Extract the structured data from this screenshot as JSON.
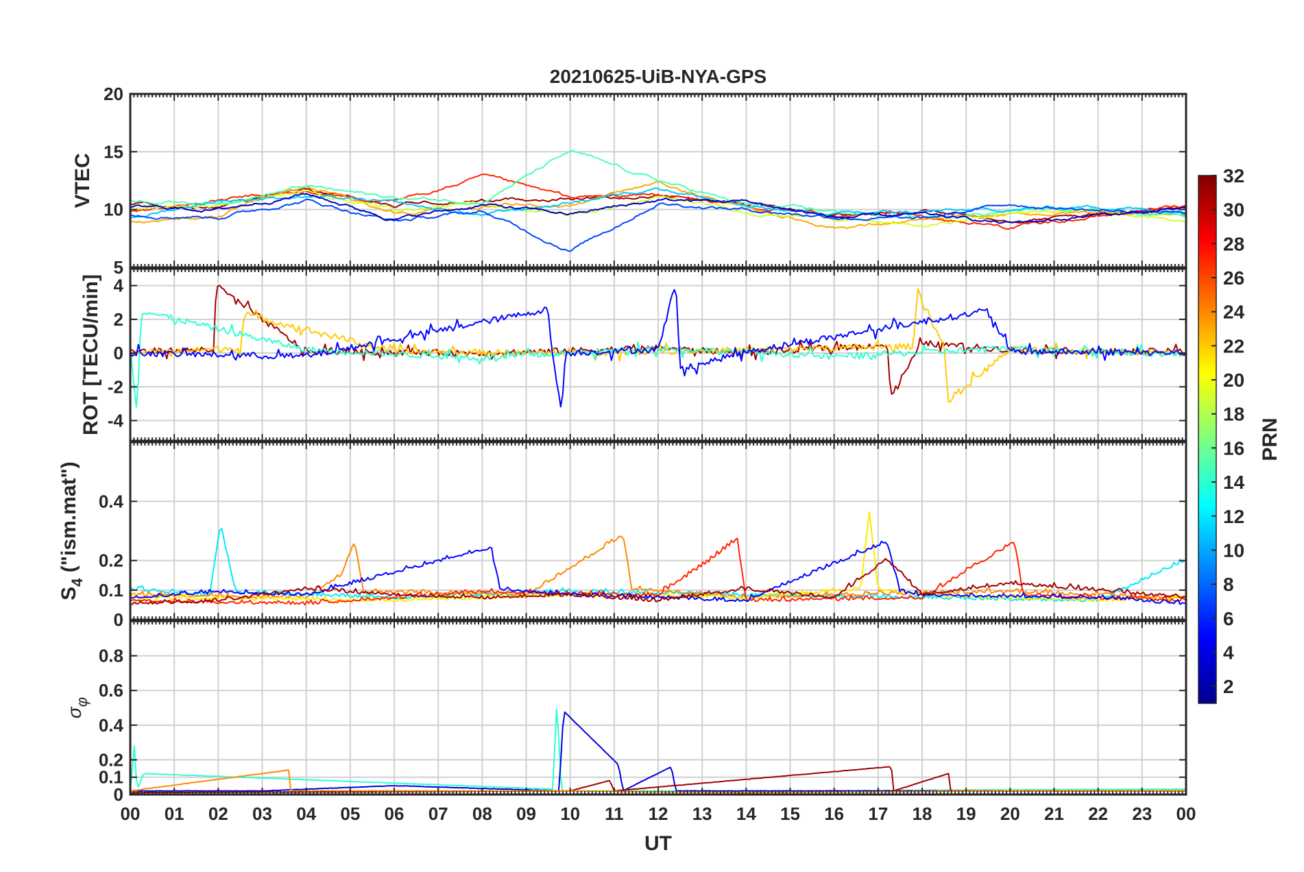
{
  "chart_data": {
    "type": "line",
    "title": "20210625-UiB-NYA-GPS",
    "xlabel": "UT",
    "x_tick_labels": [
      "00",
      "01",
      "02",
      "03",
      "04",
      "05",
      "06",
      "07",
      "08",
      "09",
      "10",
      "11",
      "12",
      "13",
      "14",
      "15",
      "16",
      "17",
      "18",
      "19",
      "20",
      "21",
      "22",
      "23",
      "00"
    ],
    "x_range_hours": [
      0,
      24
    ],
    "grid": true,
    "colormap": "jet",
    "colorbar": {
      "label": "PRN",
      "range": [
        1,
        32
      ],
      "ticks": [
        2,
        4,
        6,
        8,
        10,
        12,
        14,
        16,
        18,
        20,
        22,
        24,
        26,
        28,
        30,
        32
      ],
      "tick_labels": [
        "2",
        "4",
        "6",
        "8",
        "10",
        "12",
        "14",
        "16",
        "18",
        "20",
        "22",
        "24",
        "26",
        "28",
        "30",
        "32"
      ]
    },
    "panels": [
      {
        "id": "vtec",
        "ylabel": "VTEC",
        "ylim": [
          5,
          20
        ],
        "yticks": [
          5,
          10,
          15,
          20
        ],
        "ytick_labels": [
          "5",
          "10",
          "15",
          "20"
        ],
        "baseline": 10,
        "series": [
          {
            "prn": 31,
            "x": [
              0,
              2,
              4,
              6,
              8,
              10,
              12,
              14,
              16,
              18,
              20,
              22,
              24
            ],
            "y": [
              10.5,
              10.2,
              11.8,
              10.4,
              10.8,
              11.0,
              11.2,
              10.6,
              9.5,
              9.8,
              9.2,
              9.6,
              10.1
            ]
          },
          {
            "prn": 27,
            "x": [
              0,
              2,
              4,
              6,
              8,
              10,
              12,
              14,
              16,
              18,
              20,
              22,
              24
            ],
            "y": [
              9.8,
              10.8,
              11.5,
              10.6,
              12.8,
              11.0,
              11.3,
              10.2,
              9.6,
              9.4,
              8.5,
              9.4,
              10.4
            ]
          },
          {
            "prn": 23,
            "x": [
              0,
              2,
              4,
              6,
              8,
              10,
              12,
              14,
              16,
              18,
              20,
              22,
              24
            ],
            "y": [
              9.0,
              9.5,
              12.0,
              9.8,
              10.2,
              10.4,
              12.3,
              10.1,
              8.5,
              9.0,
              9.5,
              9.8,
              9.6
            ]
          },
          {
            "prn": 19,
            "x": [
              0,
              2,
              4,
              6,
              8,
              10,
              12,
              14,
              16,
              18,
              20,
              22,
              24
            ],
            "y": [
              10.0,
              10.4,
              11.6,
              10.0,
              10.5,
              9.5,
              11.0,
              9.8,
              9.3,
              8.5,
              9.7,
              10.0,
              9.0
            ]
          },
          {
            "prn": 15,
            "x": [
              0,
              2,
              4,
              6,
              8,
              10,
              12,
              14,
              16,
              18,
              20,
              22,
              24
            ],
            "y": [
              10.8,
              10.6,
              12.0,
              11.0,
              10.7,
              15.0,
              12.5,
              10.4,
              9.8,
              9.3,
              9.9,
              10.2,
              9.3
            ]
          },
          {
            "prn": 11,
            "x": [
              0,
              2,
              4,
              6,
              8,
              10,
              12,
              14,
              16,
              18,
              20,
              22,
              24
            ],
            "y": [
              9.3,
              10.8,
              11.2,
              10.5,
              9.5,
              10.6,
              12.0,
              10.2,
              9.6,
              9.8,
              10.0,
              10.3,
              9.8
            ]
          },
          {
            "prn": 7,
            "x": [
              0,
              2,
              4,
              6,
              8,
              10,
              12,
              14,
              16,
              18,
              20,
              22,
              24
            ],
            "y": [
              9.6,
              9.4,
              10.8,
              9.0,
              9.8,
              6.5,
              10.6,
              10.0,
              9.4,
              9.1,
              10.5,
              9.9,
              9.7
            ]
          },
          {
            "prn": 3,
            "x": [
              0,
              2,
              4,
              6,
              8,
              10,
              12,
              14,
              16,
              18,
              20,
              22,
              24
            ],
            "y": [
              10.2,
              10.0,
              11.4,
              9.2,
              10.4,
              9.6,
              10.8,
              10.7,
              9.3,
              9.5,
              8.8,
              9.5,
              10.0
            ]
          }
        ]
      },
      {
        "id": "rot",
        "ylabel": "ROT [TECU/min]",
        "ylim": [
          -5.2,
          5
        ],
        "yticks": [
          -4,
          -2,
          0,
          2,
          4
        ],
        "ytick_labels": [
          "-4",
          "-2",
          "0",
          "2",
          "4"
        ],
        "baseline": 0,
        "series": [
          {
            "prn": 31,
            "x": [
              0,
              1.9,
              1.95,
              4,
              8,
              12,
              14,
              17.2,
              17.3,
              18,
              20,
              22,
              24
            ],
            "y": [
              0.1,
              0.2,
              4.0,
              0.1,
              0,
              0.3,
              0,
              0.5,
              -2.5,
              0.6,
              0.2,
              0.1,
              0.1
            ]
          },
          {
            "prn": 22,
            "x": [
              0,
              2.5,
              2.6,
              6,
              10,
              14,
              17.8,
              17.9,
              18.5,
              18.6,
              20,
              24
            ],
            "y": [
              0,
              0.3,
              2.3,
              0.1,
              0,
              0.2,
              0.4,
              3.8,
              0.3,
              -2.8,
              0.2,
              0
            ]
          },
          {
            "prn": 14,
            "x": [
              0,
              0.15,
              0.25,
              4,
              8,
              12,
              16,
              20,
              24
            ],
            "y": [
              0.4,
              -3.5,
              2.5,
              0.2,
              -0.3,
              0.3,
              -0.2,
              0.3,
              -0.1
            ]
          },
          {
            "prn": 5,
            "x": [
              0,
              4,
              9.5,
              9.6,
              9.8,
              9.9,
              12,
              12.4,
              12.5,
              14,
              19.5,
              20,
              24
            ],
            "y": [
              0,
              -0.2,
              2.6,
              -0.2,
              -3.4,
              0,
              0.2,
              4.2,
              -1.0,
              0.1,
              2.5,
              0.1,
              0
            ]
          }
        ]
      },
      {
        "id": "s4",
        "ylabel": "S4 (\"ism.mat\")",
        "ylim": [
          0,
          0.6
        ],
        "yticks": [
          0,
          0.1,
          0.2,
          0.4
        ],
        "ytick_labels": [
          "0",
          "0.1",
          "0.2",
          "0.4"
        ],
        "baseline": 0.06,
        "series": [
          {
            "prn": 12,
            "x": [
              0,
              1.8,
              2.05,
              2.4,
              6,
              10,
              14,
              18,
              22,
              24
            ],
            "y": [
              0.1,
              0.08,
              0.32,
              0.09,
              0.07,
              0.09,
              0.08,
              0.07,
              0.06,
              0.2
            ]
          },
          {
            "prn": 24,
            "x": [
              0,
              4,
              4.8,
              5.1,
              5.3,
              9,
              11.2,
              11.4,
              14,
              16,
              20,
              24
            ],
            "y": [
              0.08,
              0.07,
              0.15,
              0.26,
              0.09,
              0.08,
              0.28,
              0.1,
              0.07,
              0.08,
              0.09,
              0.07
            ]
          },
          {
            "prn": 21,
            "x": [
              0,
              6,
              10,
              14,
              16.6,
              16.8,
              17,
              18,
              22,
              24
            ],
            "y": [
              0.07,
              0.06,
              0.08,
              0.07,
              0.1,
              0.36,
              0.1,
              0.08,
              0.06,
              0.07
            ]
          },
          {
            "prn": 27,
            "x": [
              0,
              4,
              8,
              12,
              13.2,
              13.8,
              14,
              18,
              20.1,
              20.3,
              22,
              24
            ],
            "y": [
              0.06,
              0.05,
              0.09,
              0.08,
              0.2,
              0.27,
              0.06,
              0.07,
              0.26,
              0.08,
              0.07,
              0.06
            ]
          },
          {
            "prn": 5,
            "x": [
              0,
              2,
              4,
              8.2,
              8.4,
              10,
              14,
              17.2,
              17.5,
              18,
              22,
              24
            ],
            "y": [
              0.07,
              0.09,
              0.08,
              0.24,
              0.1,
              0.08,
              0.06,
              0.26,
              0.09,
              0.08,
              0.07,
              0.05
            ]
          },
          {
            "prn": 31,
            "x": [
              0,
              2,
              4,
              6,
              8,
              10,
              12,
              14,
              16,
              17.2,
              18,
              20,
              24
            ],
            "y": [
              0.05,
              0.06,
              0.1,
              0.08,
              0.07,
              0.08,
              0.06,
              0.1,
              0.07,
              0.2,
              0.08,
              0.12,
              0.07
            ]
          }
        ]
      },
      {
        "id": "sigma_phi",
        "ylabel": "σφ",
        "ylim": [
          0,
          1
        ],
        "yticks": [
          0,
          0.1,
          0.2,
          0.4,
          0.6,
          0.8
        ],
        "ytick_labels": [
          "0",
          "0.1",
          "0.2",
          "0.4",
          "0.6",
          "0.8"
        ],
        "baseline": 0.02,
        "series": [
          {
            "prn": 14,
            "x": [
              0,
              0.1,
              0.15,
              0.3,
              9.6,
              9.7,
              9.8,
              15,
              24
            ],
            "y": [
              0.02,
              0.3,
              0.02,
              0.12,
              0.03,
              0.53,
              0.02,
              0.02,
              0.03
            ]
          },
          {
            "prn": 4,
            "x": [
              0,
              3,
              6,
              9.75,
              9.85,
              11.1,
              11.2,
              12.3,
              12.4,
              15,
              24
            ],
            "y": [
              0.02,
              0.02,
              0.05,
              0.02,
              0.48,
              0.17,
              0.02,
              0.16,
              0.02,
              0.02,
              0.02
            ]
          },
          {
            "prn": 31,
            "x": [
              0,
              10,
              10.9,
              11,
              17.3,
              17.35,
              18.6,
              18.65,
              24
            ],
            "y": [
              0.01,
              0.02,
              0.08,
              0.02,
              0.16,
              0.02,
              0.12,
              0.02,
              0.02
            ]
          },
          {
            "prn": 24,
            "x": [
              0,
              3.6,
              3.65,
              10,
              14,
              20,
              24
            ],
            "y": [
              0.02,
              0.14,
              0.02,
              0.02,
              0.01,
              0.02,
              0.02
            ]
          }
        ]
      }
    ]
  }
}
